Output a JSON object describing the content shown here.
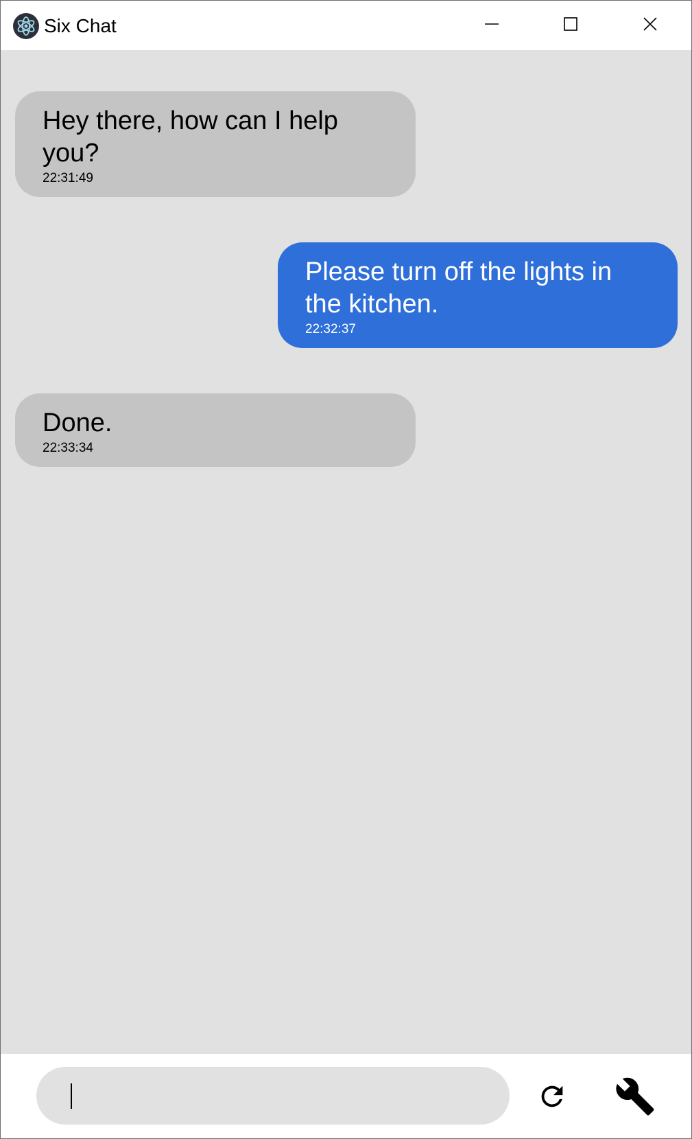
{
  "window": {
    "title": "Six Chat",
    "icon": "electron-atom-icon"
  },
  "titlebar_controls": [
    {
      "name": "minimize",
      "icon": "minimize-icon"
    },
    {
      "name": "maximize",
      "icon": "maximize-icon"
    },
    {
      "name": "close",
      "icon": "close-icon"
    }
  ],
  "messages": [
    {
      "sender": "bot",
      "text": "Hey there, how can I help you?",
      "time": "22:31:49"
    },
    {
      "sender": "user",
      "text": "Please turn off the lights in the kitchen.",
      "time": "22:32:37"
    },
    {
      "sender": "bot",
      "text": "Done.",
      "time": "22:33:34"
    }
  ],
  "composer": {
    "value": "",
    "placeholder": ""
  },
  "actions": {
    "refresh_icon": "refresh-icon",
    "settings_icon": "wrench-icon"
  },
  "colors": {
    "chat_background": "#e1e1e1",
    "bot_bubble": "#c4c4c4",
    "user_bubble": "#2e6fd9",
    "user_text": "#ffffff",
    "bot_text": "#000000"
  }
}
